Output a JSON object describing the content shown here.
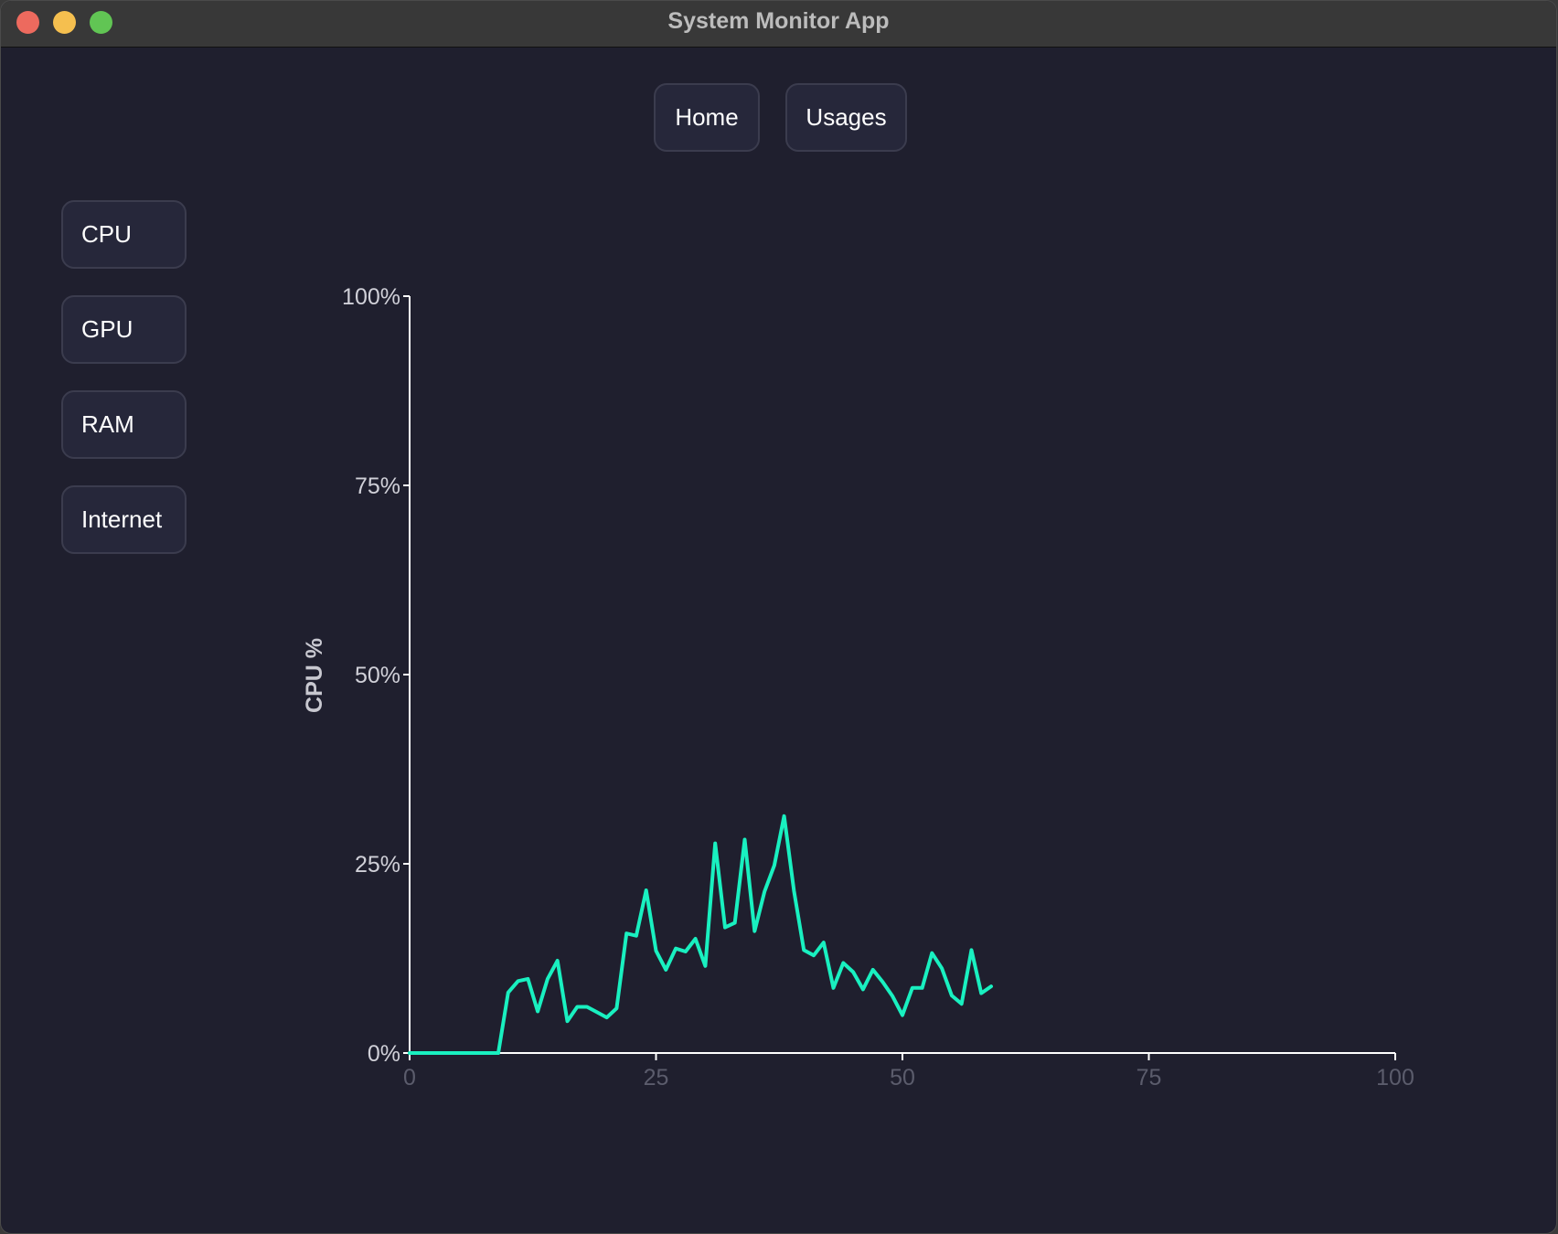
{
  "window": {
    "title": "System Monitor App"
  },
  "nav": {
    "home_label": "Home",
    "usages_label": "Usages"
  },
  "sidebar": {
    "items": [
      {
        "label": "CPU"
      },
      {
        "label": "GPU"
      },
      {
        "label": "RAM"
      },
      {
        "label": "Internet"
      }
    ]
  },
  "colors": {
    "line": "#19f0c0",
    "background": "#1f1f2e",
    "axis": "#ffffff",
    "x_tick_text": "#5b5c6c"
  },
  "chart_data": {
    "type": "line",
    "ylabel": "CPU %",
    "xlabel": "",
    "xlim": [
      0,
      100
    ],
    "ylim": [
      0,
      100
    ],
    "x_ticks": [
      "0",
      "25",
      "50",
      "75",
      "100"
    ],
    "y_ticks": [
      "0%",
      "25%",
      "50%",
      "75%",
      "100%"
    ],
    "grid": false,
    "series": [
      {
        "x": [
          0,
          1,
          2,
          3,
          4,
          5,
          6,
          7,
          8,
          9,
          10,
          11,
          12,
          13,
          14,
          15,
          16,
          17,
          18,
          19,
          20,
          21,
          22,
          23,
          24,
          25,
          26,
          27,
          28,
          29,
          30,
          31,
          32,
          33,
          34,
          35,
          36,
          37,
          38,
          39,
          40,
          41,
          42,
          43,
          44,
          45,
          46,
          47,
          48,
          49,
          50,
          51,
          52,
          53,
          54,
          55,
          56,
          57,
          58,
          59
        ],
        "values": [
          0,
          0,
          0,
          0,
          0,
          0,
          0,
          0,
          0,
          0,
          8,
          9.5,
          9.8,
          5.5,
          9.8,
          12.2,
          4.2,
          6.1,
          6.1,
          5.4,
          4.7,
          5.9,
          15.8,
          15.5,
          21.5,
          13.5,
          11,
          13.8,
          13.4,
          15.1,
          11.5,
          27.7,
          16.6,
          17.2,
          28.2,
          16.1,
          21.3,
          24.8,
          31.3,
          21.4,
          13.6,
          12.9,
          14.6,
          8.6,
          11.9,
          10.7,
          8.4,
          11,
          9.4,
          7.5,
          5,
          8.6,
          8.6,
          13.2,
          11.2,
          7.6,
          6.5,
          13.6,
          7.9,
          8.8
        ]
      }
    ]
  }
}
